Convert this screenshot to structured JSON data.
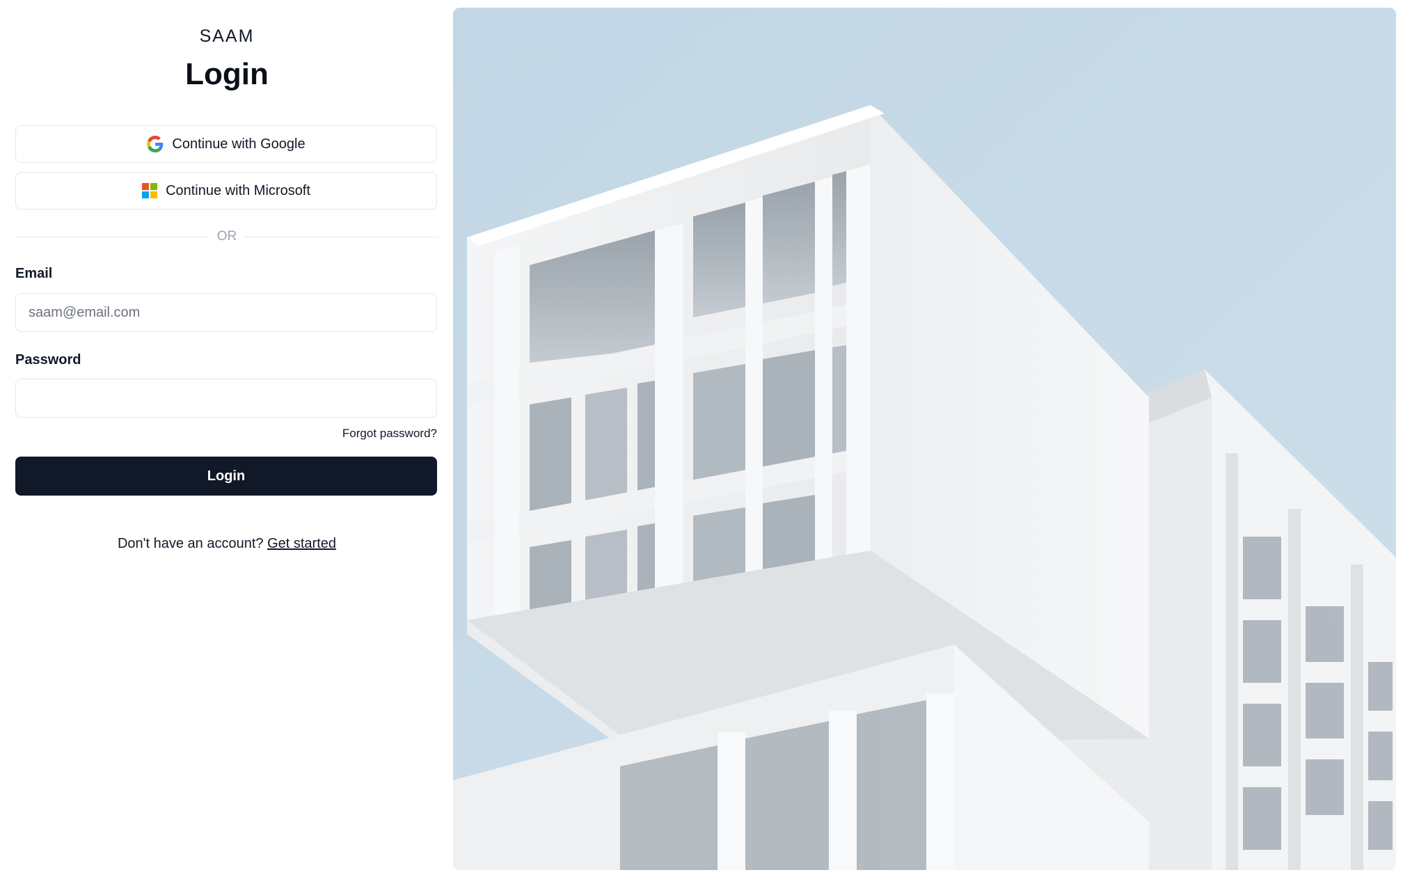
{
  "brand": "SAAM",
  "title": "Login",
  "sso": {
    "google_label": "Continue with Google",
    "microsoft_label": "Continue with Microsoft"
  },
  "divider_text": "OR",
  "form": {
    "email_label": "Email",
    "email_placeholder": "saam@email.com",
    "email_value": "",
    "password_label": "Password",
    "password_value": "",
    "forgot_label": "Forgot password?",
    "submit_label": "Login"
  },
  "signup": {
    "prompt": "Don't have an account?",
    "link_label": "Get started"
  },
  "icons": {
    "google": "google-logo-icon",
    "microsoft": "microsoft-logo-icon"
  },
  "colors": {
    "primary": "#111827",
    "sky": "#c6d8e6",
    "google_blue": "#4285F4",
    "google_red": "#EA4335",
    "google_yellow": "#FBBC05",
    "google_green": "#34A853",
    "ms_red": "#F25022",
    "ms_green": "#7FBA00",
    "ms_blue": "#00A4EF",
    "ms_yellow": "#FFB900"
  },
  "hero_image": {
    "subject": "building-photo"
  }
}
